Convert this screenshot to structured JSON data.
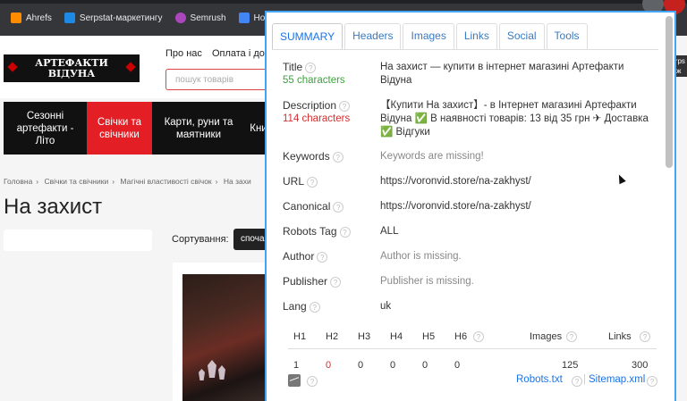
{
  "bookmarks": [
    {
      "label": "Ahrefs",
      "color": "#ff8c00"
    },
    {
      "label": "Serpstat-маркетингу",
      "color": "#1e88e5"
    },
    {
      "label": "Semrush",
      "color": "#ab47bc"
    },
    {
      "label": "Новый",
      "color": "#4285f4"
    }
  ],
  "site": {
    "logo": "АРТЕФАКТИ ВІДУНА",
    "topnav": [
      "Про нас",
      "Оплата і до"
    ],
    "search_placeholder": "пошук товарів",
    "categories": [
      {
        "label": "Сезонні артефакти - Літо",
        "active": false
      },
      {
        "label": "Свічки та свічники",
        "active": true
      },
      {
        "label": "Карти, руни та маятники",
        "active": false
      },
      {
        "label": "Кни",
        "active": false
      }
    ],
    "breadcrumbs": [
      "Головна",
      "Свічки та свічники",
      "Магічні властивості свічок",
      "На захи"
    ],
    "page_title": "На захист",
    "sort_label": "Сортування:",
    "sort_value": "споча",
    "right_tooltip": "Serps Мож"
  },
  "panel": {
    "tabs": [
      "SUMMARY",
      "Headers",
      "Images",
      "Links",
      "Social",
      "Tools"
    ],
    "active_tab": "SUMMARY",
    "title": {
      "label": "Title",
      "chars": "55 characters",
      "value": "На захист — купити в інтернет магазині Артефакти Відуна"
    },
    "description": {
      "label": "Description",
      "chars": "114 characters",
      "value": "【Купити На захист】- в Інтернет магазині Артефакти Відуна ✅ В наявності товарів: 13 від 35 грн ✈ Доставка ✅ Відгуки"
    },
    "keywords": {
      "label": "Keywords",
      "value": "Keywords are missing!"
    },
    "url": {
      "label": "URL",
      "value": "https://voronvid.store/na-zakhyst/"
    },
    "canonical": {
      "label": "Canonical",
      "value": "https://voronvid.store/na-zakhyst/"
    },
    "robots": {
      "label": "Robots Tag",
      "value": "ALL"
    },
    "author": {
      "label": "Author",
      "value": "Author is missing."
    },
    "publisher": {
      "label": "Publisher",
      "value": "Publisher is missing."
    },
    "lang": {
      "label": "Lang",
      "value": "uk"
    },
    "headings": {
      "cols": [
        "H1",
        "H2",
        "H3",
        "H4",
        "H5",
        "H6",
        "Images",
        "Links"
      ],
      "values": [
        "1",
        "0",
        "0",
        "0",
        "0",
        "0",
        "125",
        "300"
      ]
    },
    "robots_link": "Robots.txt",
    "sitemap_link": "Sitemap.xml",
    "colors": {
      "accent": "#1a73e8",
      "ok": "#3aa33a",
      "warn": "#d32f2f",
      "border": "#42a5f5"
    }
  }
}
